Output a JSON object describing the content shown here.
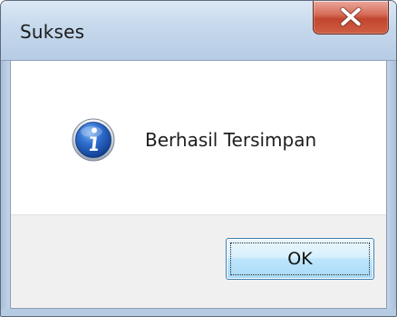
{
  "window": {
    "title": "Sukses"
  },
  "message": {
    "icon": "info-icon",
    "text": "Berhasil Tersimpan"
  },
  "buttons": {
    "ok_label": "OK"
  },
  "colors": {
    "titlebar": "#c5d8ec",
    "close_button": "#c2462f",
    "info_icon": "#1f5fc4",
    "ok_button": "#bee6fd",
    "button_area": "#f0f0f0"
  }
}
